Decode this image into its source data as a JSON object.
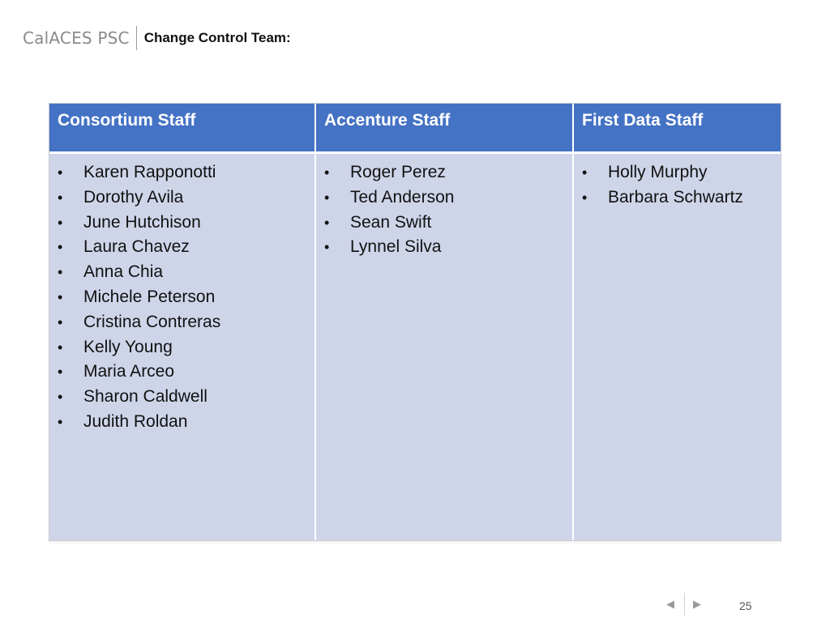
{
  "header": {
    "brand": "CalACES PSC",
    "title": "Change Control Team:"
  },
  "table": {
    "columns": [
      {
        "heading": "Consortium Staff",
        "members": [
          "Karen Rapponotti",
          "Dorothy Avila",
          "June Hutchison",
          "Laura Chavez",
          "Anna Chia",
          "Michele Peterson",
          "Cristina Contreras",
          "Kelly Young",
          "Maria Arceo",
          "Sharon Caldwell",
          "Judith Roldan"
        ]
      },
      {
        "heading": "Accenture Staff",
        "members": [
          "Roger Perez",
          "Ted Anderson",
          "Sean Swift",
          "Lynnel Silva"
        ]
      },
      {
        "heading": "First Data Staff",
        "members": [
          "Holly Murphy",
          "Barbara Schwartz"
        ]
      }
    ]
  },
  "footer": {
    "prev_icon": "◀",
    "next_icon": "▶",
    "page_number": "25"
  },
  "colors": {
    "header_fill": "#4472c4",
    "cell_fill": "#cfd5e9"
  }
}
